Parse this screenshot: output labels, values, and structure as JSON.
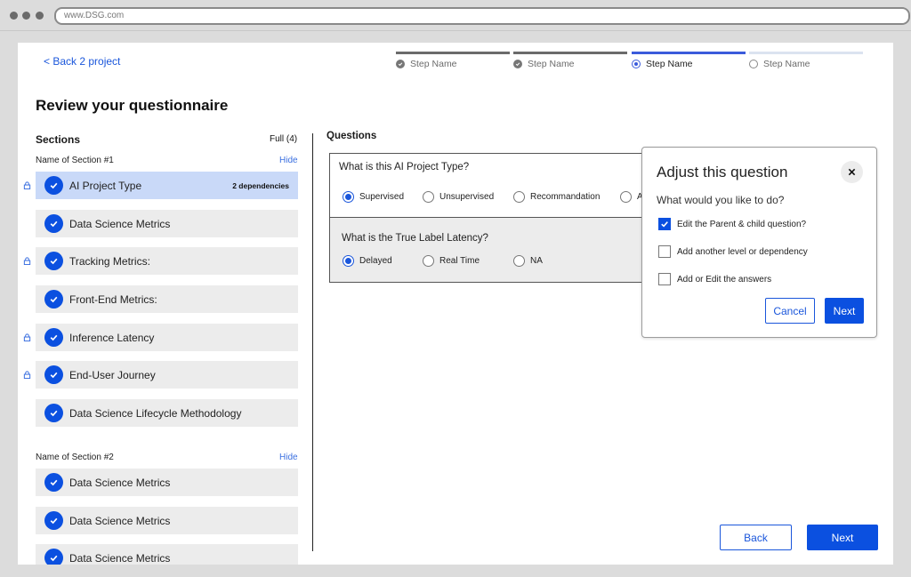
{
  "browser": {
    "url": "www.DSG.com"
  },
  "nav": {
    "back_label": "< Back 2 project"
  },
  "stepper": [
    {
      "label": "Step Name",
      "state": "complete"
    },
    {
      "label": "Step Name",
      "state": "complete"
    },
    {
      "label": "Step Name",
      "state": "current"
    },
    {
      "label": "Step Name",
      "state": "upcoming"
    }
  ],
  "page": {
    "title": "Review your questionnaire"
  },
  "sidebar": {
    "title": "Sections",
    "count": "Full (4)",
    "groups": [
      {
        "name": "Name of Section #1",
        "hide_label": "Hide",
        "items": [
          {
            "label": "AI Project Type",
            "badge": "2 dependencies",
            "locked": true,
            "active": true
          },
          {
            "label": "Data Science Metrics",
            "locked": false
          },
          {
            "label": "Tracking Metrics:",
            "locked": true
          },
          {
            "label": "Front-End Metrics:",
            "locked": false
          },
          {
            "label": "Inference Latency",
            "locked": true
          },
          {
            "label": "End-User Journey",
            "locked": true
          },
          {
            "label": "Data Science Lifecycle Methodology",
            "locked": false
          }
        ]
      },
      {
        "name": "Name of Section #2",
        "hide_label": "Hide",
        "items": [
          {
            "label": "Data Science Metrics"
          },
          {
            "label": "Data Science Metrics"
          },
          {
            "label": "Data Science Metrics"
          }
        ]
      }
    ]
  },
  "questions": {
    "title": "Questions",
    "items": [
      {
        "text": "What is this AI Project Type?",
        "options": [
          "Supervised",
          "Unsupervised",
          "Recommandation",
          "A"
        ],
        "selected": 0
      },
      {
        "text": "What is the True Label Latency?",
        "options": [
          "Delayed",
          "Real Time",
          "NA"
        ],
        "selected": 0
      }
    ]
  },
  "modal": {
    "title": "Adjust this question",
    "subtitle": "What would you like to do?",
    "options": [
      {
        "label": "Edit the Parent & child question?",
        "checked": true
      },
      {
        "label": "Add another level  or dependency",
        "checked": false
      },
      {
        "label": "Add or Edit the answers",
        "checked": false
      }
    ],
    "cancel_label": "Cancel",
    "next_label": "Next"
  },
  "footer": {
    "back_label": "Back",
    "next_label": "Next"
  },
  "colors": {
    "accent": "#0b50e0",
    "link": "#1a56db",
    "active_item": "#c9d9f8"
  }
}
